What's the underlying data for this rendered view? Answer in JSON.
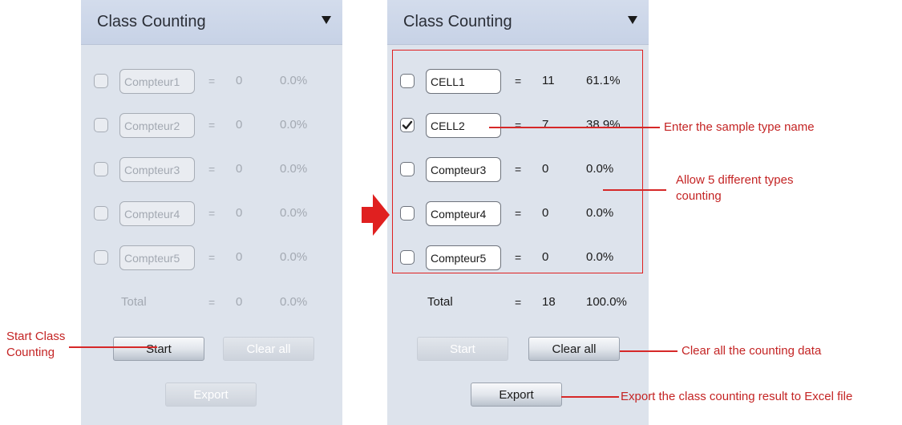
{
  "panel_before": {
    "title": "Class Counting",
    "rows": [
      {
        "checked": false,
        "name": "Compteur1",
        "eq": "=",
        "count": "0",
        "percent": "0.0%"
      },
      {
        "checked": false,
        "name": "Compteur2",
        "eq": "=",
        "count": "0",
        "percent": "0.0%"
      },
      {
        "checked": false,
        "name": "Compteur3",
        "eq": "=",
        "count": "0",
        "percent": "0.0%"
      },
      {
        "checked": false,
        "name": "Compteur4",
        "eq": "=",
        "count": "0",
        "percent": "0.0%"
      },
      {
        "checked": false,
        "name": "Compteur5",
        "eq": "=",
        "count": "0",
        "percent": "0.0%"
      }
    ],
    "total": {
      "label": "Total",
      "eq": "=",
      "count": "0",
      "percent": "0.0%"
    },
    "buttons": {
      "start": "Start",
      "clear_all": "Clear all",
      "export": "Export"
    }
  },
  "panel_after": {
    "title": "Class Counting",
    "rows": [
      {
        "checked": false,
        "name": "CELL1",
        "eq": "=",
        "count": "11",
        "percent": "61.1%"
      },
      {
        "checked": true,
        "name": "CELL2",
        "eq": "=",
        "count": "7",
        "percent": "38.9%"
      },
      {
        "checked": false,
        "name": "Compteur3",
        "eq": "=",
        "count": "0",
        "percent": "0.0%"
      },
      {
        "checked": false,
        "name": "Compteur4",
        "eq": "=",
        "count": "0",
        "percent": "0.0%"
      },
      {
        "checked": false,
        "name": "Compteur5",
        "eq": "=",
        "count": "0",
        "percent": "0.0%"
      }
    ],
    "total": {
      "label": "Total",
      "eq": "=",
      "count": "18",
      "percent": "100.0%"
    },
    "buttons": {
      "start": "Start",
      "clear_all": "Clear all",
      "export": "Export"
    }
  },
  "annotations": {
    "start": "Start Class\nCounting",
    "sample_name": "Enter the sample type name",
    "five_types": "Allow 5 different types\ncounting",
    "clear_all": "Clear all the counting data",
    "export": "Export the class counting result to Excel file"
  },
  "colors": {
    "panel_bg": "#dde3ec",
    "header_bg": "#c7d2e6",
    "annotation_red": "#c42424",
    "arrow_red": "#e02020"
  },
  "icons": {
    "collapse": "triangle-down-icon",
    "check": "checkmark-icon",
    "transition": "right-arrow-icon"
  }
}
